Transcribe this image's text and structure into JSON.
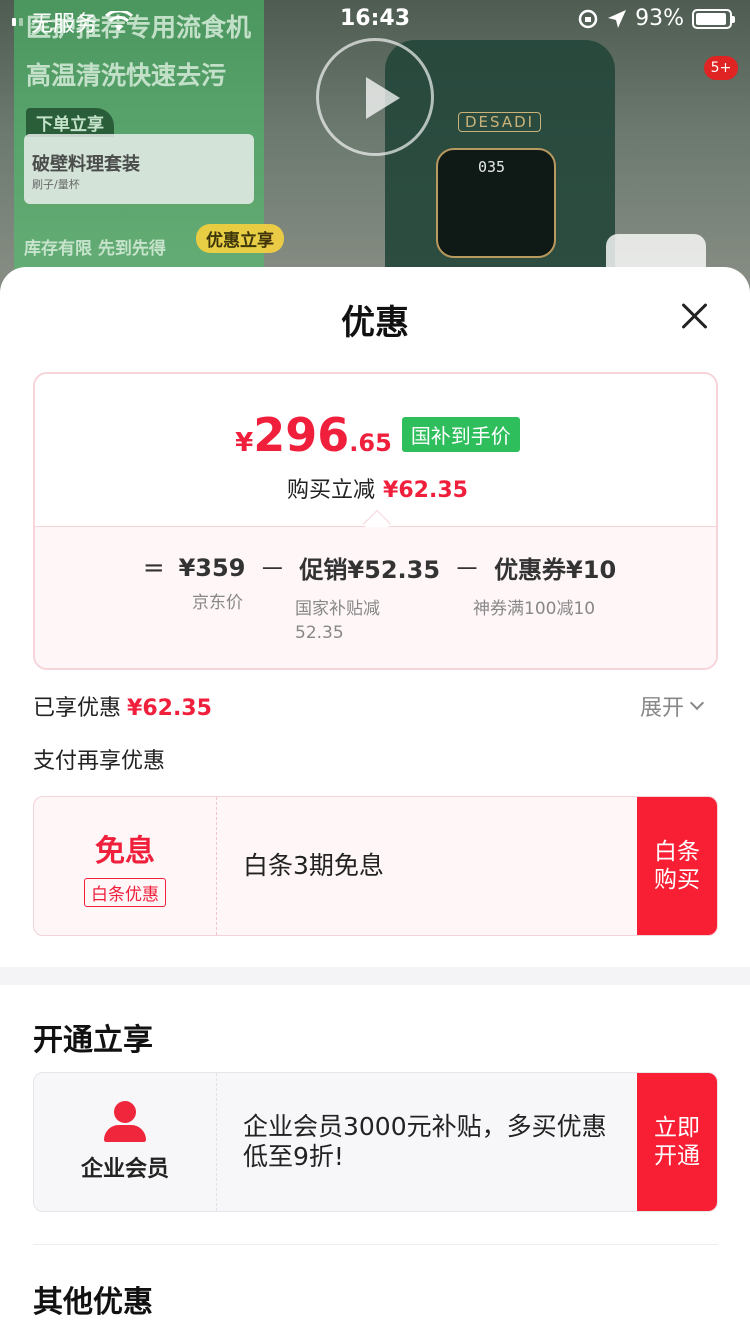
{
  "status_bar": {
    "carrier": "无服务",
    "time": "16:43",
    "battery": "93%",
    "battery_level": 0.93
  },
  "background": {
    "ad_line_1": "医护推荐专用流食机",
    "ad_line_2": "高温清洗快速去污",
    "ad_tag": "下单立享",
    "kit_title": "破壁料理套装",
    "kit_sub": "刷子/量杯",
    "stock_text": "库存有限 先到先得",
    "offer_pill": "优惠立享",
    "device_brand": "DESADI",
    "device_time": "035",
    "badge": "5+"
  },
  "sheet": {
    "title": "优惠"
  },
  "price_card": {
    "currency": "¥",
    "price_int": "296",
    "price_dec": ".65",
    "price_tag": "国补到手价",
    "save_label": "购买立减",
    "save_value": "¥62.35",
    "formula": {
      "equals": "=",
      "minus": "－",
      "jd_price": "¥359",
      "jd_label": "京东价",
      "promo": "促销¥52.35",
      "promo_label": "国家补贴减52.35",
      "coupon": "优惠券¥10",
      "coupon_label": "神券满100减10"
    }
  },
  "applied": {
    "label": "已享优惠",
    "value": "¥62.35",
    "expand": "展开"
  },
  "pay_section": {
    "title": "支付再享优惠"
  },
  "baitiao_offer": {
    "main": "免息",
    "tag": "白条优惠",
    "desc": "白条3期免息",
    "button": "白条购买"
  },
  "membership_section": {
    "title": "开通立享"
  },
  "membership_offer": {
    "label": "企业会员",
    "desc": "企业会员3000元补贴，多买优惠低至9折!",
    "button": "立即开通"
  },
  "other_section": {
    "title": "其他优惠"
  },
  "colors": {
    "accent_red": "#f0203c",
    "tag_green": "#2ebe5c",
    "card_pink": "#fef6f7"
  }
}
